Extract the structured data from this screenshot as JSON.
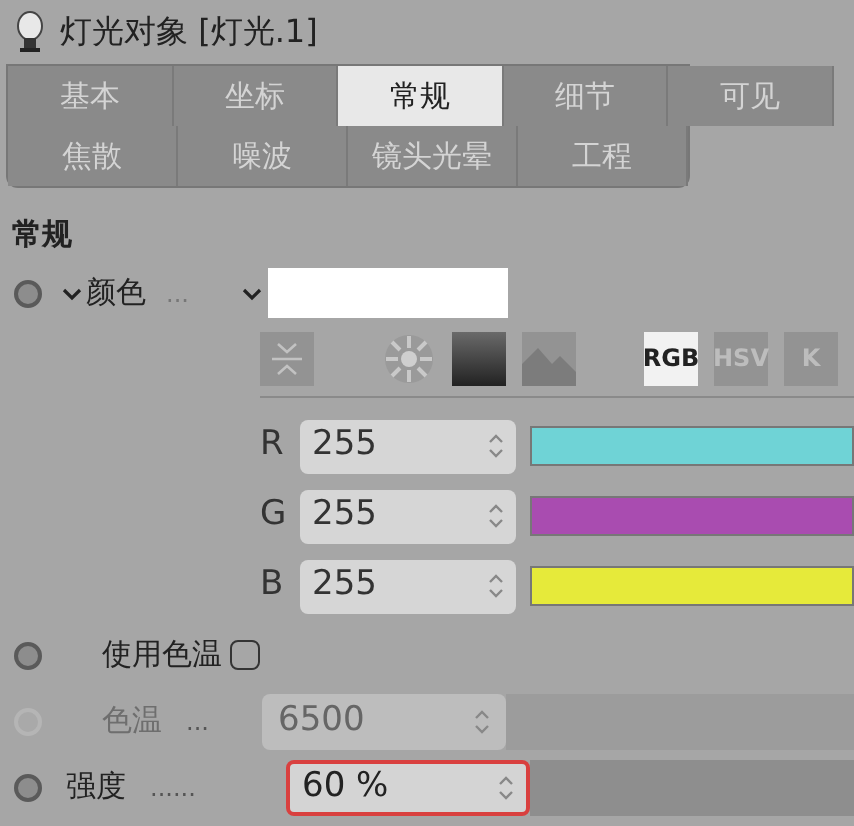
{
  "window": {
    "title": "灯光对象 [灯光.1]"
  },
  "tabs": [
    [
      {
        "label": "基本",
        "selected": false
      },
      {
        "label": "坐标",
        "selected": false
      },
      {
        "label": "常规",
        "selected": true
      },
      {
        "label": "细节",
        "selected": false
      },
      {
        "label": "可见",
        "selected": false
      }
    ],
    [
      {
        "label": "焦散",
        "selected": false
      },
      {
        "label": "噪波",
        "selected": false
      },
      {
        "label": "镜头光晕",
        "selected": false
      },
      {
        "label": "工程",
        "selected": false
      }
    ]
  ],
  "section": "常规",
  "color": {
    "label": "颜色",
    "leader": "...",
    "modes": [
      {
        "kind": "icon",
        "selected": false
      },
      {
        "kind": "icon",
        "selected": false
      },
      {
        "kind": "icon",
        "selected": false
      },
      {
        "kind": "icon",
        "selected": false
      },
      {
        "kind": "text",
        "label": "RGB",
        "selected": true
      },
      {
        "kind": "text",
        "label": "HSV",
        "selected": false
      },
      {
        "kind": "text",
        "label": "K",
        "selected": false
      }
    ]
  },
  "channels": [
    {
      "name": "R",
      "value": "255",
      "color": "#6fd3d6"
    },
    {
      "name": "G",
      "value": "255",
      "color": "#a94cb0"
    },
    {
      "name": "B",
      "value": "255",
      "color": "#e6ea3a"
    }
  ],
  "use_temperature": {
    "label": "使用色温",
    "checked": false
  },
  "temperature": {
    "label": "色温",
    "leader": "...",
    "value": "6500",
    "disabled": true
  },
  "intensity": {
    "label": "强度",
    "leader": "......",
    "value": "60 %",
    "highlighted": true
  }
}
